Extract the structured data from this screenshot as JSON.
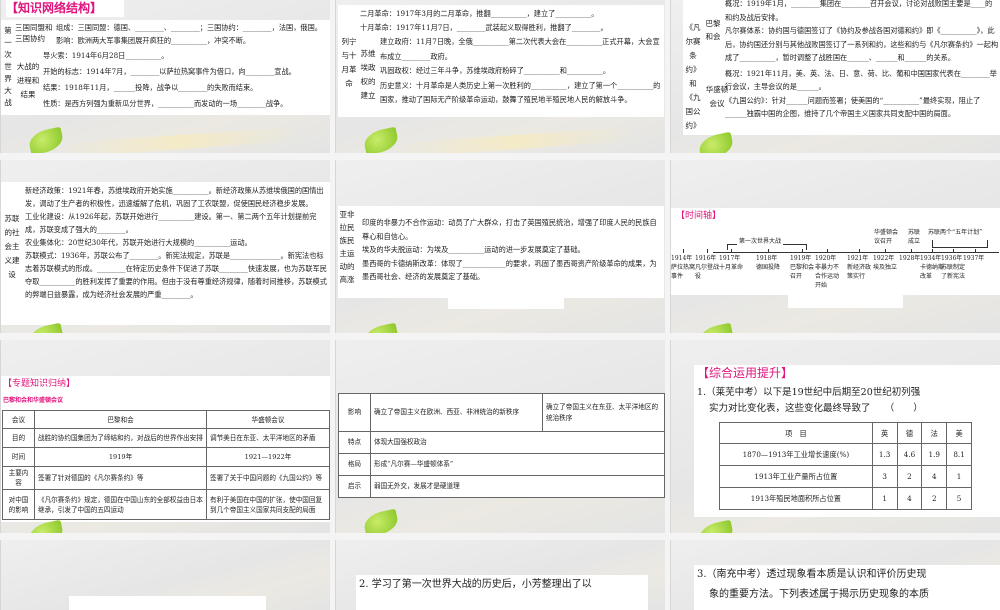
{
  "s1": {
    "title": "【知识网络结构】",
    "topic": "第一次世界大战",
    "g1": "三国同盟和三国协约",
    "g2": "大战的进程和结果",
    "lines": [
      "组成：三国同盟：德国、________、________；三国协约：________，法国，俄国。",
      "影响：欧洲两大军事集团展开疯狂的__________，冲突不断。",
      "导火索：1914年6月28日__________。",
      "开始的标志：1914年7月，________以萨拉热窝事件为借口，向________宣战。",
      "结果：1918年11月，______投降，战争以________的失败而结束。",
      "性质：是西方列强为重新瓜分世界，__________而发动的一场________战争。"
    ]
  },
  "s2": {
    "topic": "列宁与十月革命",
    "g": "苏维埃政权的建立",
    "lines": [
      "二月革命：1917年3月的二月革命，推翻__________，建立了__________。",
      "十月革命：1917年11月7日，________武装起义取得胜利，推翻了________。",
      "建立政府：11月7日晚，全俄__________第二次代表大会在__________正式开幕，大会宣布成立________政府。",
      "巩固政权：经过三年斗争，苏维埃政府粉碎了__________和__________。",
      "历史意义：十月革命是人类历史上第一次胜利的__________，建立了第一个__________的国家，推动了国际无产阶级革命运动，鼓舞了殖民地半殖民地人民的解放斗争。"
    ]
  },
  "s3": {
    "topic": "《凡尔赛条约》和《九国公约》",
    "g1": "巴黎和会",
    "g2": "华盛顿会议",
    "lines": [
      "概况：1919年1月，________集团在________召开会议，讨论对战败国主要是____的和约及战后安排。",
      "凡尔赛体系：协约国与德国签订了《协约及参战各国对德和约》即《__________》，此后，协约国还分别与其他战败国签订了一系列和约，这些和约与《凡尔赛条约》一起构成了__________，暂时调整了战胜国在______、______和______的关系。",
      "概况：1921年11月，美、英、法、日、意、荷、比、葡和中国国家代表在________举行会议，主导会议的是______。",
      "《九国公约》：针对______问题而签署；使美国的“__________”最终实现，阻止了______独霸中国的企图，维持了几个帝国主义国家共同支配中国的局面。"
    ]
  },
  "s4": {
    "topic": "苏联的社会主义建设",
    "lines": [
      "新经济政策：1921年春，苏维埃政府开始实施__________。新经济政策从苏维埃俄国的国情出发，调动了生产者的积极性，迅速缓解了危机，巩固了工农联盟，促使国民经济稳步发展。",
      "工业化建设：从1926年起，苏联开始进行__________建设。第一、第二两个五年计划提前完成，苏联变成了强大的________。",
      "农业集体化：20世纪30年代，苏联开始进行大规模的__________运动。",
      "苏联模式：1936年，苏联公布了________。新宪法规定，苏联是______________。新宪法也标志着苏联模式的形成。________在特定历史条件下促进了苏联________快速发展，也为苏联军民夺取__________的胜利发挥了重要的作用。但由于没有尊重经济规律，随着时间推移，苏联模式的弊端日益暴露，成为经济社会发展的严重________。"
    ]
  },
  "s5": {
    "topic": "亚非拉民族民主运动的高涨",
    "lines": [
      "印度的非暴力不合作运动：动员了广大群众，打击了英国殖民统治，增强了印度人民的民族自尊心和自信心。",
      "埃及的华夫脱运动：为埃及__________运动的进一步发展奠定了基础。",
      "墨西哥的卡德纳斯改革：体现了____________的要求，巩固了墨西哥资产阶级革命的成果，为墨西哥社会、经济的发展奠定了基础。"
    ]
  },
  "s6": {
    "title": "【时间轴】",
    "ww1": "第一次世界大战",
    "top1": "华盛顿会议召开",
    "top2": "苏联成立",
    "top3": "苏联两个“五年计划”",
    "events": [
      {
        "year": "1914年",
        "label": "萨拉热窝事件"
      },
      {
        "year": "1916年",
        "label": "凡尔登战役"
      },
      {
        "year": "1917年",
        "label": "十月革命"
      },
      {
        "year": "1918年",
        "label": "德国投降"
      },
      {
        "year": "1919年",
        "label": "巴黎和会召开"
      },
      {
        "year": "1920年",
        "label": "非暴力不合作运动开始"
      },
      {
        "year": "1921年",
        "label": "新经济政策实行"
      },
      {
        "year": "1922年",
        "label": "埃及独立"
      },
      {
        "year": "1928年",
        "label": ""
      },
      {
        "year": "1934年",
        "label": "卡德纳斯改革"
      },
      {
        "year": "1936年",
        "label": "苏联制定了新宪法"
      },
      {
        "year": "1937年",
        "label": ""
      }
    ]
  },
  "s7": {
    "title": "【专题知识归纳】",
    "subtitle": "巴黎和会和华盛顿会议",
    "rows": [
      [
        "会议",
        "巴黎和会",
        "华盛顿会议"
      ],
      [
        "目的",
        "战胜的协约国集团为了缔结和约，对战后的世界作出安排",
        "调节美日在东亚、太平洋地区的矛盾"
      ],
      [
        "时间",
        "1919年",
        "1921—1922年"
      ],
      [
        "主要内容",
        "签署了针对德国的《凡尔赛条约》等",
        "签署了关于中国问题的《九国公约》等"
      ],
      [
        "对中国的影响",
        "《凡尔赛条约》规定，德国在中国山东的全部权益由日本继承，引发了中国的五四运动",
        "有利于美国在中国的扩张，使中国回复到几个帝国主义国家共同支配的局面"
      ]
    ]
  },
  "s8": {
    "rows": [
      [
        "影响",
        "确立了帝国主义在欧洲、西亚、非洲统治的新秩序",
        "确立了帝国主义在东亚、太平洋地区的统治秩序"
      ],
      [
        "特点",
        "体现大国强权政治"
      ],
      [
        "格局",
        "形成“凡尔赛—华盛顿体系”"
      ],
      [
        "启示",
        "弱国无外交，发展才是硬道理"
      ]
    ]
  },
  "s9": {
    "title": "【综合运用提升】",
    "q1": "1.（莱芜中考）以下是19世纪中后期至20世纪初列强",
    "q2": "实力对比变化表，这些变化最终导致了　　（　　）",
    "rows": [
      [
        "项　目",
        "英",
        "德",
        "法",
        "美"
      ],
      [
        "1870—1913年工业增长速度(%)",
        "1.3",
        "4.6",
        "1.9",
        "8.1"
      ],
      [
        "1913年工业产量所占位置",
        "3",
        "2",
        "4",
        "1"
      ],
      [
        "1913年殖民地面积所占位置",
        "1",
        "4",
        "2",
        "5"
      ]
    ]
  },
  "s11": {
    "q": "2. 学习了第一次世界大战的历史后，小芳整理出了以"
  },
  "s12": {
    "q1": "3.（南充中考）透过现象看本质是认识和评价历史现",
    "q2": "象的重要方法。下列表述属于揭示历史现象的本质"
  }
}
